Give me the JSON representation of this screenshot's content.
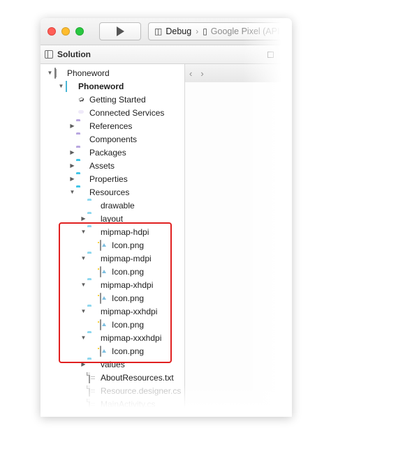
{
  "window": {
    "traffic_lights": [
      "close",
      "minimize",
      "maximize"
    ],
    "run_button_label": "run-play",
    "config": {
      "configuration": "Debug",
      "separator": "›",
      "device": "Google Pixel (API"
    }
  },
  "pad": {
    "title": "Solution",
    "pin_label": "▫",
    "close_label": "✕"
  },
  "editor": {
    "back_arrow": "‹",
    "forward_arrow": "›"
  },
  "accent": {
    "folder_blue": "#41c5e8",
    "folder_light": "#8fd8ef",
    "folder_purple": "#b9a7e0",
    "highlight_red": "#e02020"
  },
  "tree": [
    {
      "indent": 0,
      "twisty": "▼",
      "icon": "solution-icon",
      "label": "Phoneword",
      "bold": false,
      "dim": false
    },
    {
      "indent": 1,
      "twisty": "▼",
      "icon": "project-icon",
      "label": "Phoneword",
      "bold": true,
      "dim": false
    },
    {
      "indent": 2,
      "twisty": "",
      "icon": "rocket-icon",
      "label": "Getting Started",
      "bold": false,
      "dim": false
    },
    {
      "indent": 2,
      "twisty": "",
      "icon": "connected-services-icon",
      "label": "Connected Services",
      "bold": false,
      "dim": false
    },
    {
      "indent": 2,
      "twisty": "▶",
      "icon": "references-folder-icon",
      "label": "References",
      "bold": false,
      "dim": false
    },
    {
      "indent": 2,
      "twisty": "",
      "icon": "components-folder-icon",
      "label": "Components",
      "bold": false,
      "dim": false
    },
    {
      "indent": 2,
      "twisty": "▶",
      "icon": "packages-folder-icon",
      "label": "Packages",
      "bold": false,
      "dim": false
    },
    {
      "indent": 2,
      "twisty": "▶",
      "icon": "folder-icon",
      "label": "Assets",
      "bold": false,
      "dim": false
    },
    {
      "indent": 2,
      "twisty": "▶",
      "icon": "folder-icon",
      "label": "Properties",
      "bold": false,
      "dim": false
    },
    {
      "indent": 2,
      "twisty": "▼",
      "icon": "folder-icon",
      "label": "Resources",
      "bold": false,
      "dim": false
    },
    {
      "indent": 3,
      "twisty": "",
      "icon": "folder-light-icon",
      "label": "drawable",
      "bold": false,
      "dim": false
    },
    {
      "indent": 3,
      "twisty": "▶",
      "icon": "folder-light-icon",
      "label": "layout",
      "bold": false,
      "dim": false
    },
    {
      "indent": 3,
      "twisty": "▼",
      "icon": "folder-light-icon",
      "label": "mipmap-hdpi",
      "bold": false,
      "dim": false
    },
    {
      "indent": 4,
      "twisty": "",
      "icon": "image-file-icon",
      "label": "Icon.png",
      "bold": false,
      "dim": false
    },
    {
      "indent": 3,
      "twisty": "▼",
      "icon": "folder-light-icon",
      "label": "mipmap-mdpi",
      "bold": false,
      "dim": false
    },
    {
      "indent": 4,
      "twisty": "",
      "icon": "image-file-icon",
      "label": "Icon.png",
      "bold": false,
      "dim": false
    },
    {
      "indent": 3,
      "twisty": "▼",
      "icon": "folder-light-icon",
      "label": "mipmap-xhdpi",
      "bold": false,
      "dim": false
    },
    {
      "indent": 4,
      "twisty": "",
      "icon": "image-file-icon",
      "label": "Icon.png",
      "bold": false,
      "dim": false
    },
    {
      "indent": 3,
      "twisty": "▼",
      "icon": "folder-light-icon",
      "label": "mipmap-xxhdpi",
      "bold": false,
      "dim": false
    },
    {
      "indent": 4,
      "twisty": "",
      "icon": "image-file-icon",
      "label": "Icon.png",
      "bold": false,
      "dim": false
    },
    {
      "indent": 3,
      "twisty": "▼",
      "icon": "folder-light-icon",
      "label": "mipmap-xxxhdpi",
      "bold": false,
      "dim": false
    },
    {
      "indent": 4,
      "twisty": "",
      "icon": "image-file-icon",
      "label": "Icon.png",
      "bold": false,
      "dim": false
    },
    {
      "indent": 3,
      "twisty": "▶",
      "icon": "folder-light-icon",
      "label": "values",
      "bold": false,
      "dim": false
    },
    {
      "indent": 3,
      "twisty": "",
      "icon": "text-file-icon",
      "label": "AboutResources.txt",
      "bold": false,
      "dim": false
    },
    {
      "indent": 3,
      "twisty": "",
      "icon": "text-file-icon-faded",
      "label": "Resource.designer.cs",
      "bold": false,
      "dim": true
    },
    {
      "indent": 3,
      "twisty": "",
      "icon": "text-file-icon-faded",
      "label": "MainActivity.cs",
      "bold": false,
      "dim": true
    }
  ]
}
